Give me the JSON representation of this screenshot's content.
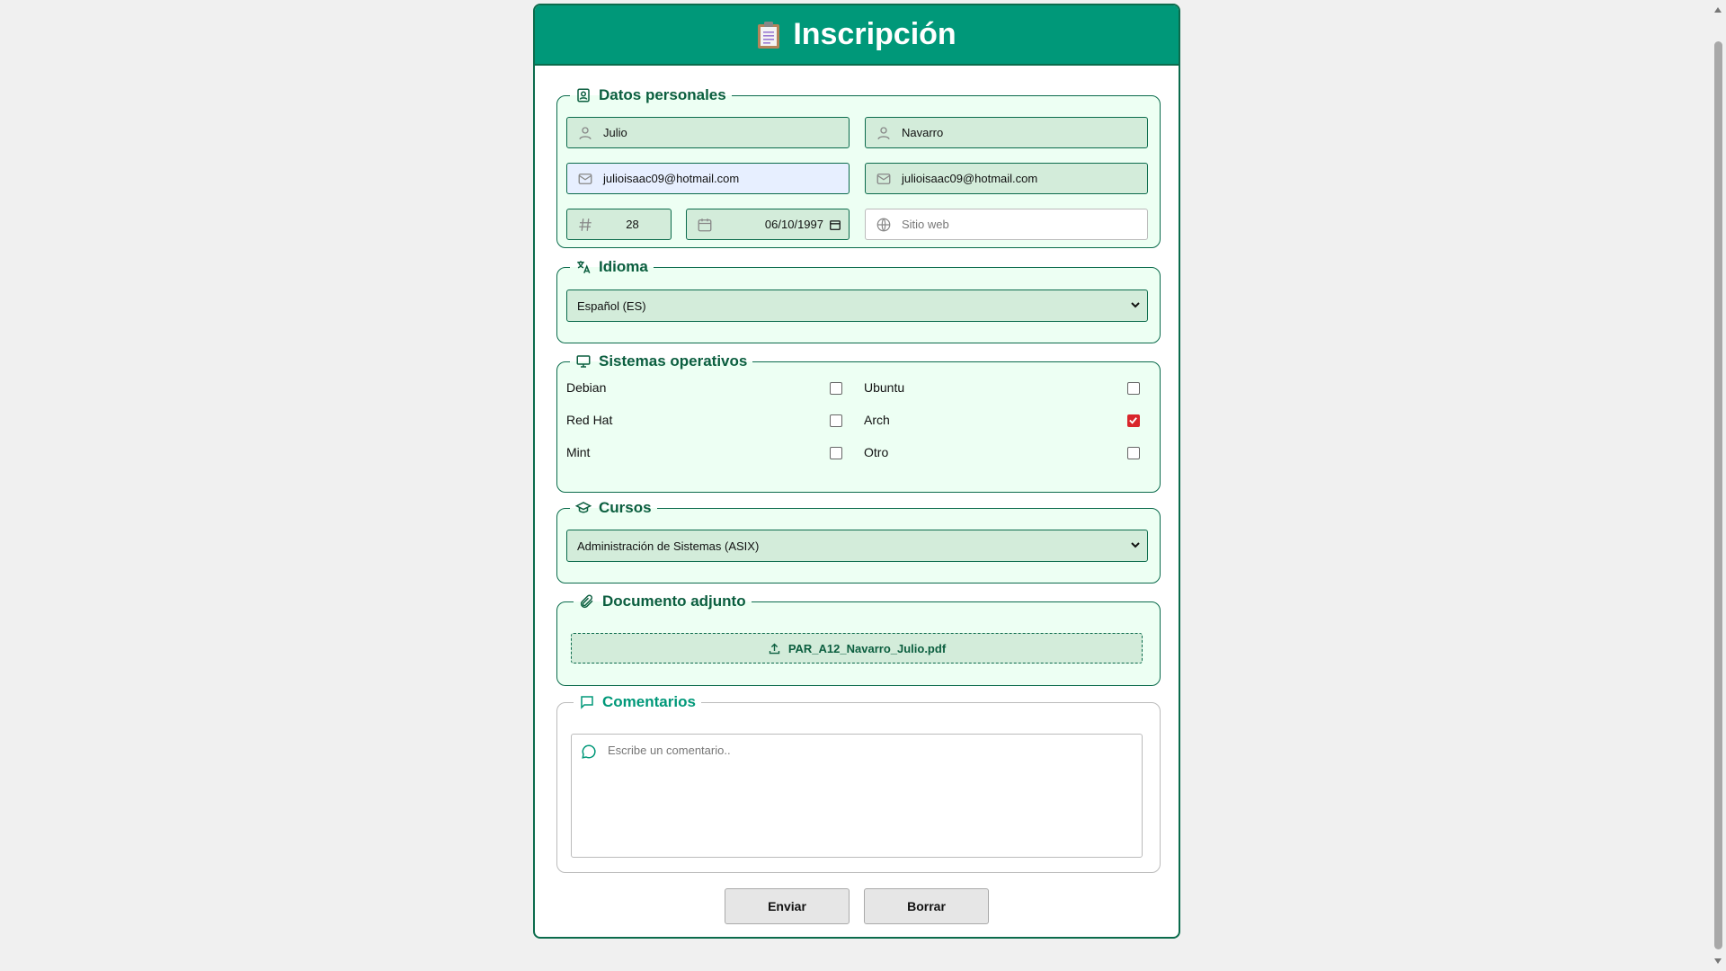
{
  "header": {
    "title": "Inscripción",
    "icon": "clipboard-icon"
  },
  "personal": {
    "legend": "Datos personales",
    "first_name": "Julio",
    "last_name": "Navarro",
    "email": "julioisaac09@hotmail.com",
    "email_confirm": "julioisaac09@hotmail.com",
    "age": "28",
    "birthdate": "06/10/1997",
    "website_placeholder": "Sitio web"
  },
  "language": {
    "legend": "Idioma",
    "selected": "Español (ES)"
  },
  "os": {
    "legend": "Sistemas operativos",
    "items": [
      {
        "label": "Debian",
        "checked": false
      },
      {
        "label": "Ubuntu",
        "checked": false
      },
      {
        "label": "Red Hat",
        "checked": false
      },
      {
        "label": "Arch",
        "checked": true
      },
      {
        "label": "Mint",
        "checked": false
      },
      {
        "label": "Otro",
        "checked": false
      }
    ]
  },
  "courses": {
    "legend": "Cursos",
    "selected": "Administración de Sistemas (ASIX)"
  },
  "attachment": {
    "legend": "Documento adjunto",
    "filename": "PAR_A12_Navarro_Julio.pdf"
  },
  "comments": {
    "legend": "Comentarios",
    "placeholder": "Escribe un comentario.."
  },
  "buttons": {
    "submit": "Enviar",
    "reset": "Borrar"
  },
  "colors": {
    "primary": "#009879",
    "border": "#0b6b4c",
    "field_bg": "#d3ecda",
    "section_bg": "#edfff3",
    "checked": "#d9262b"
  }
}
